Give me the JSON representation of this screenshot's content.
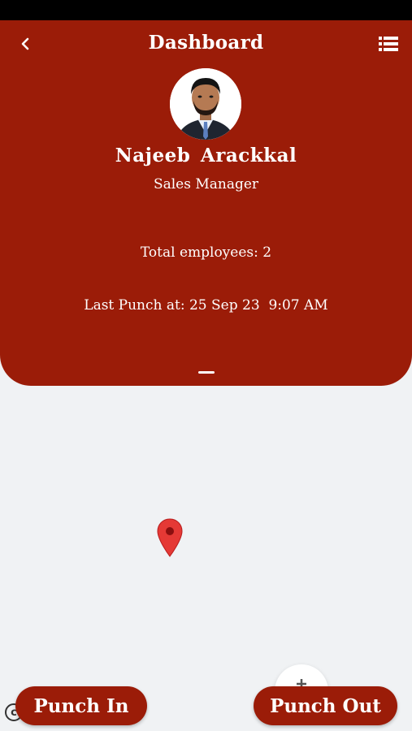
{
  "header": {
    "title": "Dashboard",
    "back_icon": "chevron-left-icon",
    "menu_icon": "list-menu-icon",
    "background_color": "#9b1c08"
  },
  "profile": {
    "name": "Najeeb  Arackkal",
    "role": "Sales Manager"
  },
  "stats": {
    "total_employees": "Total employees: 2",
    "last_punch": "Last Punch at: 25 Sep 23  9:07 AM"
  },
  "map": {
    "pin_icon": "map-pin-icon",
    "pin_color": "#e53935"
  },
  "actions": {
    "punch_in_label": "Punch In",
    "punch_out_label": "Punch Out",
    "fab_icon": "plus-icon"
  }
}
